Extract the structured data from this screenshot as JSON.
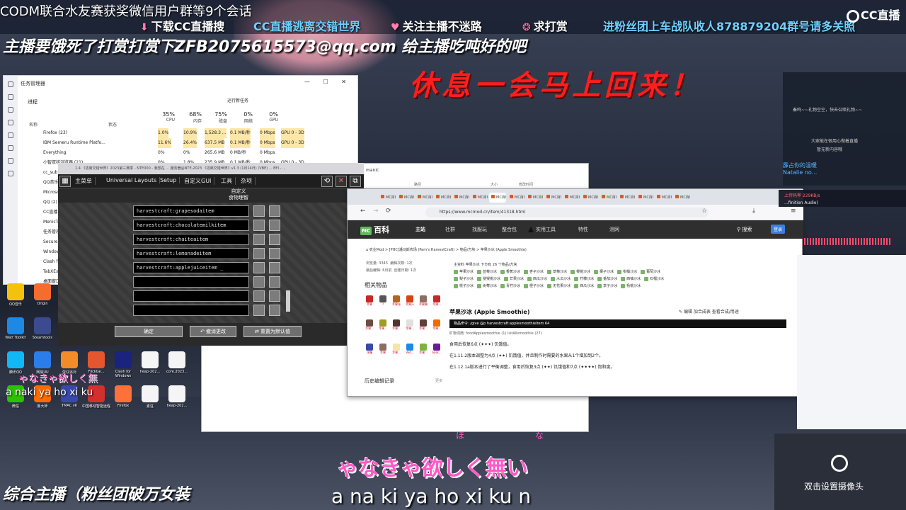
{
  "overlay": {
    "title_line": "CODM联合水友赛获奖微信用户群等9个会话",
    "line2_download": "下载CC直播搜",
    "line2_blue": "CC直播逃离交错世界",
    "line2_follow": "关注主播不迷路",
    "line2_reward": "求打赏",
    "line2_fans": "进粉丝团上车战队收人878879204群号请多关照",
    "line3": "主播要饿死了打赏打赏下ZFB2075615573@qq.com 给主播吃吨好的吧",
    "rest_banner": "休息一会马上回来！",
    "logo_text": "CC直播",
    "bottom_left": "综合主播（粉丝团破万女装",
    "camera_label": "双击设置摄像头"
  },
  "lyrics": {
    "ruby": "ほな",
    "main": "ゃなきゃ欲しく無い",
    "romaji": "a na ki ya ho xi ku n",
    "small": "ゃなきゃ欲しく無",
    "small_romaji": "a naki ya ho xi ku"
  },
  "task_manager": {
    "title": "任务管理器",
    "run_new": "运行新任务",
    "process_header": "进程",
    "col_name": "名称",
    "col_status": "状态",
    "cols": [
      {
        "pct": "35%",
        "label": "CPU"
      },
      {
        "pct": "68%",
        "label": "内存"
      },
      {
        "pct": "75%",
        "label": "磁盘"
      },
      {
        "pct": "0%",
        "label": "网络"
      },
      {
        "pct": "0%",
        "label": "GPU"
      }
    ],
    "rows": [
      {
        "name": "Firefox (23)",
        "cpu": "1.0%",
        "mem": "10.9%",
        "disk": "1,528.3 ...",
        "net": "0.1 MB/秒",
        "gpu": "0 Mbps",
        "eng": "GPU 0 - 3D"
      },
      {
        "name": "IBM Semeru Runtime Platfo...",
        "cpu": "11.6%",
        "mem": "26.4%",
        "disk": "637.5 MB",
        "net": "0.1 MB/秒",
        "gpu": "0 Mbps",
        "eng": "GPU 0 - 3D"
      },
      {
        "name": "Everything",
        "cpu": "0%",
        "mem": "0%",
        "disk": "265.6 MB",
        "net": "0 MB/秒",
        "gpu": "0 Mbps",
        "eng": ""
      },
      {
        "name": "小智双核浏览器 (21)",
        "cpu": "0%",
        "mem": "1.8%",
        "disk": "235.9 MB",
        "net": "0.1 MB/秒",
        "gpu": "0 Mbps",
        "eng": "GPU 0 - 3D"
      }
    ],
    "side_names": [
      "cc_sub.e",
      "QQ音乐",
      "Microsof",
      "QQ (2)",
      "CC直播",
      "MenicTo",
      "任务管理",
      "Secure",
      "Window",
      "Clash fo",
      "TabXExp",
      "桌面窗口"
    ]
  },
  "desktop_icons": [
    {
      "label": "QQ音乐",
      "color": "#f4c20d"
    },
    {
      "label": "Origin",
      "color": "#f56c2d"
    },
    {
      "label": "Watt Toolkit",
      "color": "#1e88e5"
    },
    {
      "label": "Steamtools",
      "color": "#3b4b8f"
    },
    {
      "label": "腾讯QQ",
      "color": "#12b7f5"
    },
    {
      "label": "网易UU",
      "color": "#2b7de9"
    },
    {
      "label": "蛋仔派对",
      "color": "#f28c28"
    },
    {
      "label": "FlickGe...",
      "color": "#e4572e"
    },
    {
      "label": "Clash for Windows",
      "color": "#1a237e"
    },
    {
      "label": "heap-202...",
      "color": "#f5f5f5"
    },
    {
      "label": "core.2023...",
      "color": "#f5f5f5"
    },
    {
      "label": "微信",
      "color": "#2dc100"
    },
    {
      "label": "鲁大师",
      "color": "#ff6b00"
    },
    {
      "label": "TMAC v6",
      "color": "#3949ab"
    },
    {
      "label": "中国移动智能远程",
      "color": "#d32f2f"
    },
    {
      "label": "Firefox",
      "color": "#ff7139"
    },
    {
      "label": "素狂",
      "color": "#f5f5f5"
    },
    {
      "label": "heap-202...",
      "color": "#f5f5f5"
    }
  ],
  "minecraft": {
    "titlebar": "1.4 《逃离交错世界》2023第三赛季 - NTE000 - 我想在 ... 服务器@NTE-2023 《逃离交错世界》v1.3 (1月14日) (VBE) ... EEI - ...",
    "menus": [
      "主菜单",
      "Universal Layouts",
      "Setup",
      "自定义GUI",
      "工具",
      "杂项"
    ],
    "sub_title": "自定义",
    "sub_title2": "食物理智",
    "inputs": [
      "harvestcraft:grapesodaitem",
      "harvestcraft:chocolatemilkitem",
      "harvestcraft:chaiteaitem",
      "harvestcraft:lemonadeitem",
      "harvestcraft:applejuiceitem _",
      "",
      "",
      ""
    ],
    "btn_done": "确定",
    "btn_undo": "撤消更改",
    "btn_reset": "重置为默认值"
  },
  "file_dialog": {
    "title": "manic",
    "col_path": "路径",
    "col_size": "大小",
    "col_date": "修改时间"
  },
  "browser": {
    "url": "https://www.mcmod.cn/item/41318.html",
    "tab_label": "MC百科",
    "nav_logo": "百科",
    "nav_mc": "MC",
    "nav_items": [
      "主站",
      "社群",
      "找服玩",
      "整合包",
      "实用工具",
      "特性",
      "测网"
    ],
    "search": "搜索",
    "login": "登录",
    "breadcrumb": "农业Mod  >  [PHC]潘马斯农场 (Pam's HarvestCraft)  >  物品/方块  >  苹果沙冰 (Apple Smoothie)",
    "meta1": "浏览量: 3345",
    "meta2": "编辑次数: 1次",
    "meta3": "最后编辑: 6月前",
    "meta4": "创建日期: 1次",
    "related": "相关物品",
    "history": "历史编辑记录",
    "history_more": "更多",
    "tags_header": "主资料  苹果沙冰  下方有 26 个物品/方块",
    "tags": [
      "苹果沙冰",
      "蓝莓沙冰",
      "香蕉沙冰",
      "杏子沙冰",
      "草莓沙冰",
      "樱桃沙冰",
      "椰子沙冰",
      "柑橘沙冰",
      "葡萄沙冰",
      "梨子沙冰",
      "猕猴桃沙冰",
      "芒果沙冰",
      "西瓜沙冰",
      "木瓜沙冰",
      "柠檬沙冰",
      "番茄沙冰",
      "西柚沙冰",
      "石榴沙冰",
      "桃子沙冰",
      "树莓沙冰",
      "青柠沙冰",
      "橙子沙冰",
      "无花果沙冰",
      "西瓜沙冰",
      "李子沙冰",
      "杨桃沙冰"
    ],
    "item_title": "苹果沙冰 (Apple Smoothie)",
    "actions": "编辑  加合成表  查看合成/用途",
    "command": "物品命令: /give @p harvestcraft:applesmoothieitem 64",
    "oredict": "矿物词典: foodApplesmoothie (1)  listAllsmoothie (27)",
    "desc1": "食用后恢复6点 (✦✦✦) 饥饿值。",
    "desc2": "在1.11.2版本调整为4点 (✦✦) 饥饿值，并且制作时需要的水果从1个增加到2个。",
    "desc3": "在1.12.1a版本进行了平衡调整，食用后恢复3点 (✦✦) 饥饿值和7点 (✦✦✦✦) 饱和度。",
    "related_items": [
      {
        "label": "苹果",
        "color": "#c62828"
      },
      {
        "label": "?",
        "color": "#555555"
      },
      {
        "label": "苹果派",
        "color": "#b5651d"
      },
      {
        "label": "苹果汁",
        "color": "#d84315"
      },
      {
        "label": "苹果酱",
        "color": "#8d6e63"
      },
      {
        "label": "苹果...",
        "color": "#c62828"
      },
      {
        "label": "苹果...",
        "color": "#6d4c41"
      },
      {
        "label": "苹果...",
        "color": "#9e9d24"
      },
      {
        "label": "苹果...",
        "color": "#4e342e"
      },
      {
        "label": "苹果...",
        "color": "#e0e0e0"
      },
      {
        "label": "苹果...",
        "color": "#5d4037"
      },
      {
        "label": "苹果...",
        "color": "#ef6c00"
      },
      {
        "label": "冰箱",
        "color": "#3949ab"
      },
      {
        "label": "苹果",
        "color": "#8d6e63"
      },
      {
        "label": "苹果...",
        "color": "#f5e6a8"
      },
      {
        "label": "Vod...",
        "color": "#1e88e5"
      },
      {
        "label": "苹果...",
        "color": "#7cb342"
      },
      {
        "label": "Sask...",
        "color": "#6a1b9a"
      }
    ]
  },
  "right_panel": {
    "line1": "秦鸣~~礼物空空，快去召唤礼物~~",
    "line2": "大家能在很用心做着直播",
    "line3": "暂无新内容哦",
    "red1": "霹占你的温暖",
    "red2": "Natalie no...",
    "hd": "上传码率 229KB/s",
    "hd2": "...finition Audio)"
  },
  "colors": {
    "accent_red": "#ff1e1e",
    "lyric_pink": "#ff59c6",
    "nav_dark": "#2f2f30",
    "mcmod_green": "#5fb85a"
  }
}
